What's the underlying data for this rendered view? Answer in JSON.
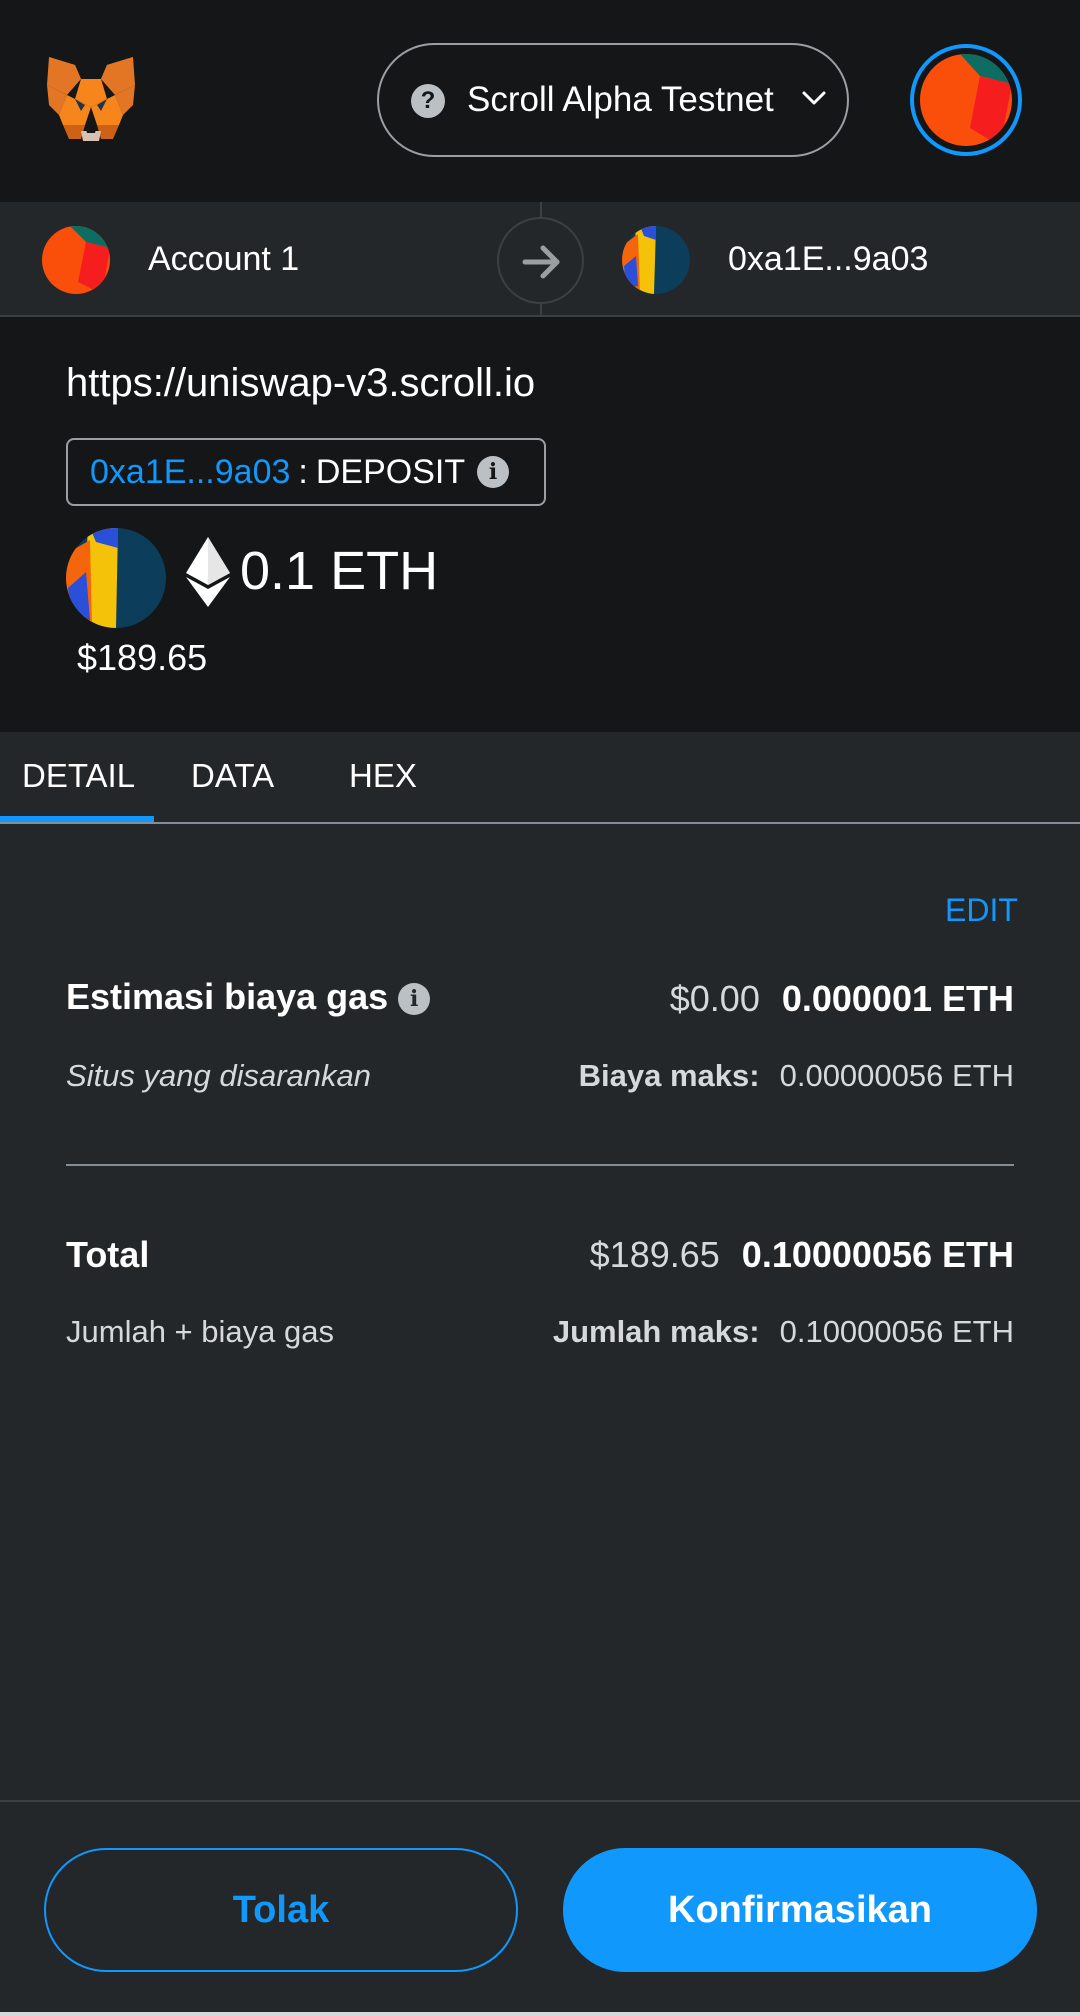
{
  "header": {
    "network_label": "Scroll Alpha Testnet",
    "network_icon": "question-icon"
  },
  "accounts": {
    "from_label": "Account 1",
    "to_label": "0xa1E...9a03"
  },
  "summary": {
    "origin": "https://uniswap-v3.scroll.io",
    "method_address": "0xa1E...9a03",
    "method_separator": ":",
    "method_name": "DEPOSIT",
    "amount": "0.1 ETH",
    "amount_fiat": "$189.65"
  },
  "tabs": {
    "detail": "DETAIL",
    "data": "DATA",
    "hex": "HEX",
    "active": "DETAIL"
  },
  "details": {
    "edit_label": "EDIT",
    "gas": {
      "title": "Estimasi biaya gas",
      "fiat": "$0.00",
      "crypto": "0.000001 ETH",
      "subtitle": "Situs yang disarankan",
      "max_label": "Biaya maks:",
      "max_value": "0.00000056 ETH"
    },
    "total": {
      "title": "Total",
      "fiat": "$189.65",
      "crypto": "0.10000056 ETH",
      "subtitle": "Jumlah + biaya gas",
      "max_label": "Jumlah maks:",
      "max_value": "0.10000056 ETH"
    }
  },
  "footer": {
    "reject_label": "Tolak",
    "confirm_label": "Konfirmasikan"
  },
  "colors": {
    "accent": "#1098fc",
    "header_bg": "#141618",
    "body_bg": "#24272a"
  }
}
